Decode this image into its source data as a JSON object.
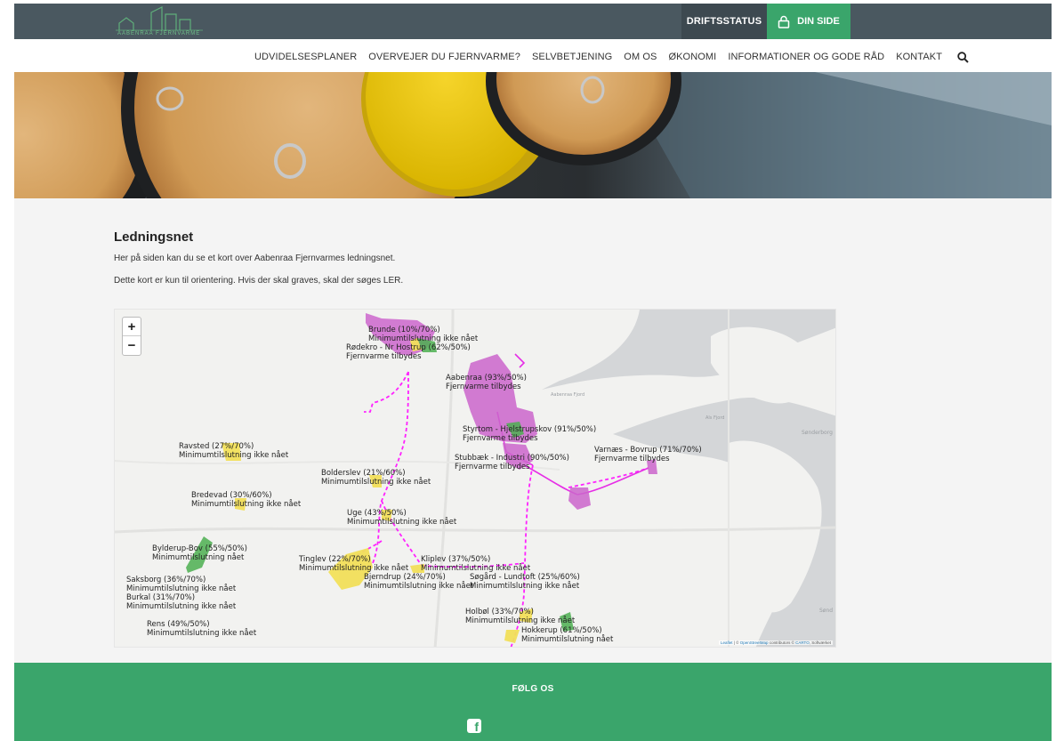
{
  "header": {
    "logo_text": "AABENRAA FJERNVARME",
    "driftsstatus": "DRIFTSSTATUS",
    "din_side": "DIN SIDE"
  },
  "nav": {
    "items": [
      "UDVIDELSESPLANER",
      "OVERVEJER DU FJERNVARME?",
      "SELVBETJENING",
      "OM OS",
      "ØKONOMI",
      "INFORMATIONER OG GODE RÅD",
      "KONTAKT"
    ]
  },
  "page": {
    "title": "Ledningsnet",
    "intro": "Her på siden kan du se et kort over Aabenraa Fjernvarmes ledningsnet.",
    "note": "Dette kort er kun til orientering. Hvis der skal graves, skal der søges LER."
  },
  "map": {
    "zoom_in": "+",
    "zoom_out": "−",
    "labels": [
      {
        "l1": "Brunde (10%/70%)",
        "l2": "Minimumtilslutning ikke nået"
      },
      {
        "l1": "Rødekro - Nr Hostrup (62%/50%)",
        "l2": "Fjernvarme tilbydes"
      },
      {
        "l1": "Aabenraa (93%/50%)",
        "l2": "Fjernvarme tilbydes"
      },
      {
        "l1": "Styrtom - Hjelstrupskov (91%/50%)",
        "l2": "Fjernvarme tilbydes"
      },
      {
        "l1": "Stubbæk - Industri (90%/50%)",
        "l2": "Fjernvarme tilbydes"
      },
      {
        "l1": "Varnæs - Bovrup (71%/70%)",
        "l2": "Fjernvarme tilbydes"
      },
      {
        "l1": "Ravsted (27%/70%)",
        "l2": "Minimumtilslutning ikke nået"
      },
      {
        "l1": "Bolderslev (21%/60%)",
        "l2": "Minimumtilslutning ikke nået"
      },
      {
        "l1": "Bredevad (30%/60%)",
        "l2": "Minimumtilslutning ikke nået"
      },
      {
        "l1": "Uge (43%/50%)",
        "l2": "Minimumtilslutning ikke nået"
      },
      {
        "l1": "Bylderup-Bov (55%/50%)",
        "l2": "Minimumtilslutning nået"
      },
      {
        "l1": "Tinglev (22%/70%)",
        "l2": "Minimumtilslutning ikke nået"
      },
      {
        "l1": "Kliplev (37%/50%)",
        "l2": "Minimumtilslutning ikke nået"
      },
      {
        "l1": "Bjerndrup (24%/70%)",
        "l2": "Minimumtilslutning ikke nået"
      },
      {
        "l1": "Søgård - Lundtoft (25%/60%)",
        "l2": "Minimumtilslutning ikke nået"
      },
      {
        "l1": "Saksborg (36%/70%)",
        "l2": "Minimumtilslutning ikke nået"
      },
      {
        "l1": "Burkal (31%/70%)",
        "l2": "Minimumtilslutning ikke nået"
      },
      {
        "l1": "Holbøl (33%/70%)",
        "l2": "Minimumtilslutning ikke nået"
      },
      {
        "l1": "Hokkerup (61%/50%)",
        "l2": "Minimumtilslutning nået"
      },
      {
        "l1": "Rens (49%/50%)",
        "l2": "Minimumtilslutning ikke nået"
      }
    ],
    "place_names": [
      "Aabenraa Fjord",
      "Als Fjord",
      "Sønderborg",
      "Sønd"
    ],
    "attribution": {
      "leaflet": "Leaflet",
      "sep1": " | © ",
      "osm": "OpenStreetMap",
      "sep2": " contributors © ",
      "carto": "CARTO",
      "sep3": ", Softværket"
    },
    "colors": {
      "network": "#cc44cc",
      "planned": "#ff22ff",
      "offered": "#cc66cc",
      "not_reached": "#f2e05a",
      "reached": "#4caf50",
      "water": "#d4d6d8"
    }
  },
  "footer": {
    "follow": "FØLG OS",
    "facebook_icon": "f"
  },
  "colors": {
    "topbar": "#4a5860",
    "green": "#3aa56b"
  }
}
